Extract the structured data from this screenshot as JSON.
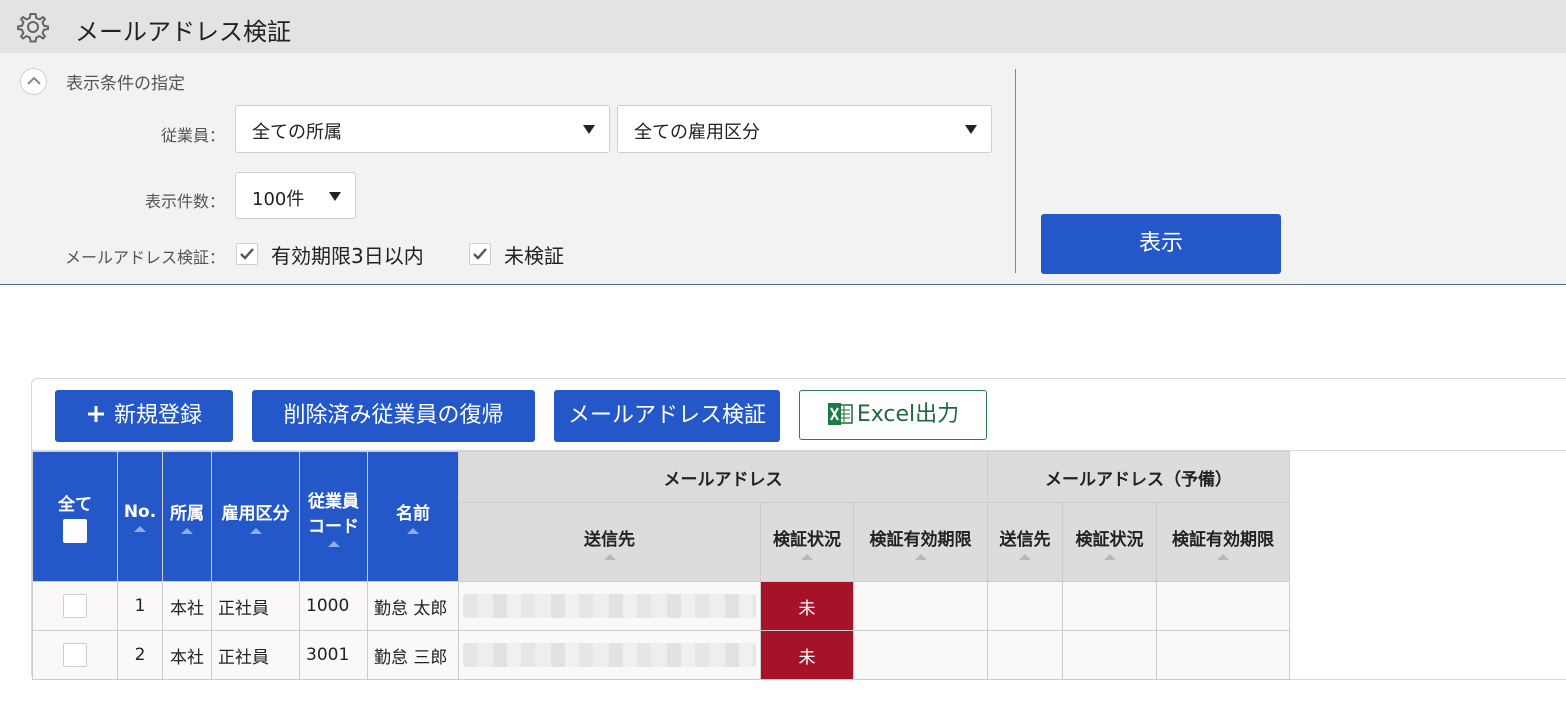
{
  "header": {
    "title": "メールアドレス検証",
    "icon": "gear-icon"
  },
  "conditions": {
    "section_title": "表示条件の指定",
    "employee_label": "従業員：",
    "affiliation_select": "全ての所属",
    "employment_select": "全ての雇用区分",
    "count_label": "表示件数：",
    "count_select": "100件",
    "verify_label": "メールアドレス検証：",
    "check1_label": "有効期限3日以内",
    "check2_label": "未検証",
    "check1_checked": true,
    "check2_checked": true,
    "show_button": "表示"
  },
  "toolbar": {
    "new_button": "新規登録",
    "restore_button": "削除済み従業員の復帰",
    "verify_button": "メールアドレス検証",
    "excel_button": "Excel出力"
  },
  "table": {
    "headers": {
      "all": "全て",
      "no": "No.",
      "affiliation": "所属",
      "employment": "雇用区分",
      "code_line1": "従業員",
      "code_line2": "コード",
      "name": "名前",
      "email_group": "メールアドレス",
      "email_backup_group": "メールアドレス（予備）",
      "send_to": "送信先",
      "verify_status": "検証状況",
      "verify_expiry": "検証有効期限",
      "send_to2": "送信先",
      "verify_status2": "検証状況",
      "verify_expiry2": "検証有効期限"
    },
    "rows": [
      {
        "no": "1",
        "affiliation": "本社",
        "employment": "正社員",
        "code": "1000",
        "name": "勤怠 太郎",
        "status": "未"
      },
      {
        "no": "2",
        "affiliation": "本社",
        "employment": "正社員",
        "code": "3001",
        "name": "勤怠 三郎",
        "status": "未"
      }
    ]
  },
  "colors": {
    "primary": "#2458c8",
    "status_red": "#a51328",
    "excel_green": "#1e6a3e"
  }
}
